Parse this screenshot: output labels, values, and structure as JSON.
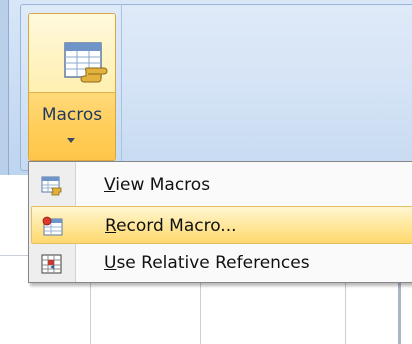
{
  "ribbon": {
    "macros_button": {
      "label": "Macros",
      "icon": "macros-sheet-scroll-icon",
      "dropdown_arrow_icon": "chevron-down-icon"
    }
  },
  "menu": {
    "items": [
      {
        "mnemonic": "V",
        "rest": "iew Macros",
        "label": "View Macros",
        "icon": "view-macros-icon",
        "highlighted": false
      },
      {
        "mnemonic": "R",
        "rest": "ecord Macro...",
        "label": "Record Macro...",
        "icon": "record-macro-icon",
        "highlighted": true
      },
      {
        "mnemonic": "U",
        "rest": "se Relative References",
        "label": "Use Relative References",
        "icon": "relative-references-icon",
        "highlighted": false
      }
    ]
  },
  "colors": {
    "ribbon_blue": "#d2e2f5",
    "hover_gold": "#ffd96e",
    "button_border": "#d9a73f",
    "menu_border": "#868686"
  }
}
